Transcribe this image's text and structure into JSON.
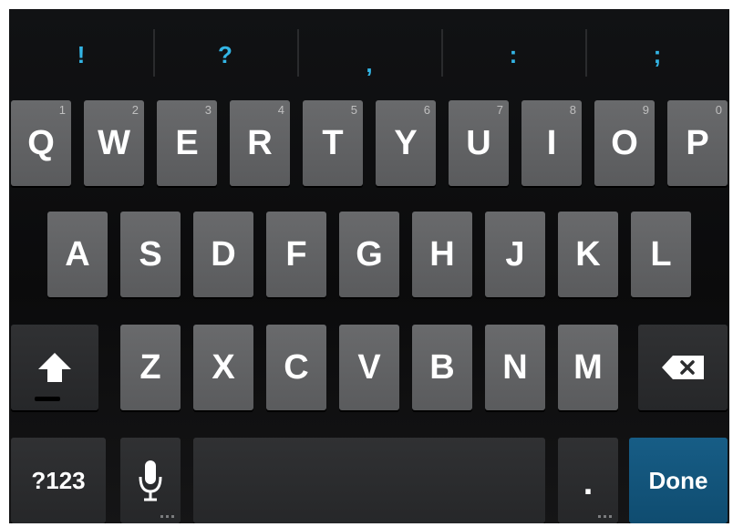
{
  "suggestions": [
    "!",
    "?",
    ",",
    ":",
    ";"
  ],
  "rows": {
    "top": [
      {
        "letter": "Q",
        "hint": "1"
      },
      {
        "letter": "W",
        "hint": "2"
      },
      {
        "letter": "E",
        "hint": "3"
      },
      {
        "letter": "R",
        "hint": "4"
      },
      {
        "letter": "T",
        "hint": "5"
      },
      {
        "letter": "Y",
        "hint": "6"
      },
      {
        "letter": "U",
        "hint": "7"
      },
      {
        "letter": "I",
        "hint": "8"
      },
      {
        "letter": "O",
        "hint": "9"
      },
      {
        "letter": "P",
        "hint": "0"
      }
    ],
    "middle": [
      "A",
      "S",
      "D",
      "F",
      "G",
      "H",
      "J",
      "K",
      "L"
    ],
    "bottom": [
      "Z",
      "X",
      "C",
      "V",
      "B",
      "N",
      "M"
    ]
  },
  "special": {
    "symbols_label": "?123",
    "period_label": ".",
    "done_label": "Done"
  },
  "icons": {
    "shift": "shift-icon",
    "backspace": "backspace-icon",
    "mic": "microphone-icon"
  },
  "colors": {
    "accent": "#33b5e5",
    "key": "#606163",
    "key_dark": "#2b2c2e",
    "done": "#135780",
    "background": "#0f1011"
  }
}
